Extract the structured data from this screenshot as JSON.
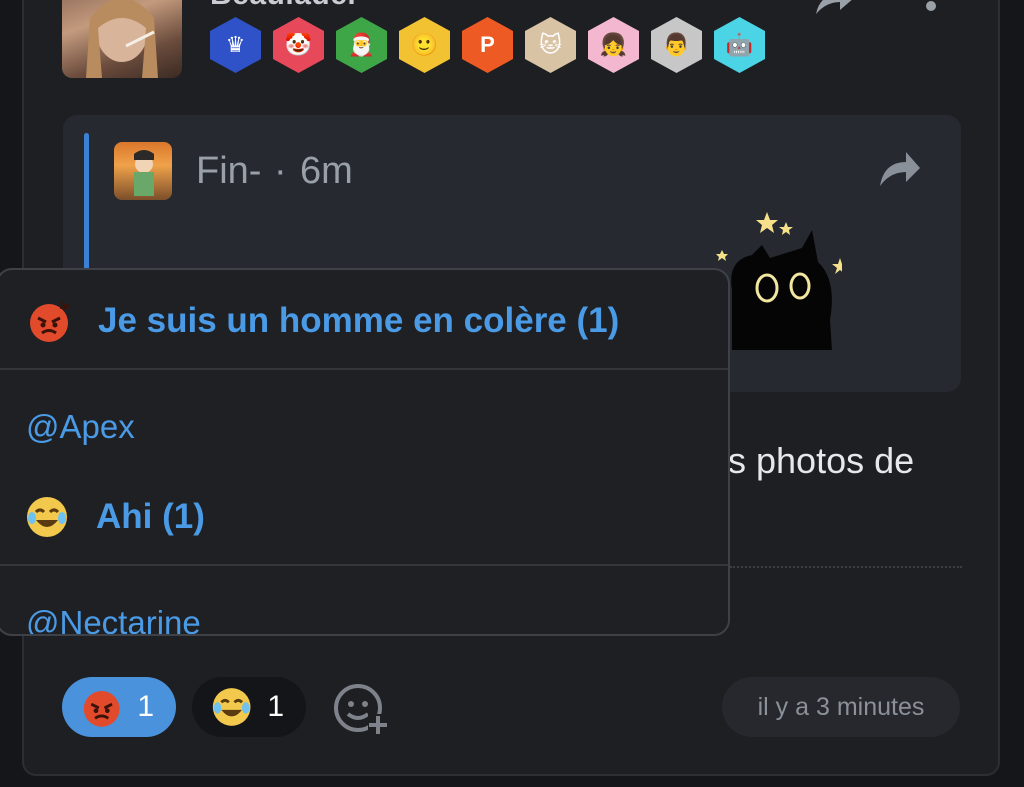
{
  "post": {
    "username": "Beaulader",
    "badges": [
      "crown-badge",
      "clown-badge",
      "santa-badge",
      "smiley-badge",
      "p-logo-badge",
      "cat-badge",
      "anime-girl-badge",
      "man-badge",
      "robot-badge"
    ]
  },
  "quote": {
    "author": "Fin-",
    "separator": "·",
    "time": "6m"
  },
  "post_text": "s photos de",
  "reaction_popup": {
    "groups": [
      {
        "emoji": "angry-face-icon",
        "label": "Je suis un homme en colère (1)",
        "users": [
          "@Apex"
        ]
      },
      {
        "emoji": "tears-of-joy-icon",
        "label": "Ahi (1)",
        "users": [
          "@Nectarine"
        ]
      }
    ]
  },
  "reactions": [
    {
      "emoji": "angry-face-icon",
      "count": "1",
      "active": true
    },
    {
      "emoji": "tears-of-joy-icon",
      "count": "1",
      "active": false
    }
  ],
  "timestamp": "il y a 3 minutes",
  "colors": {
    "accent": "#4a93dc",
    "link": "#4a9ae6",
    "background": "#1e1f23"
  }
}
